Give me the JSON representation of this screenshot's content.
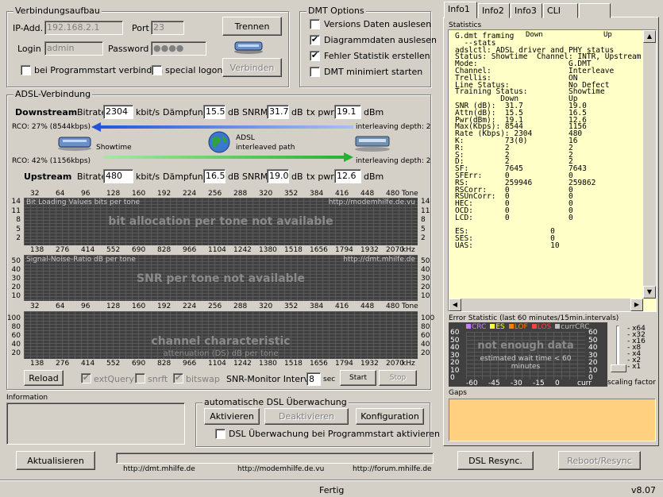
{
  "verbindung": {
    "title": "Verbindungsaufbau",
    "ip_label": "IP-Add.",
    "ip_value": "192.168.2.1",
    "port_label": "Port",
    "port_value": "23",
    "login_label": "Login",
    "login_value": "admin",
    "password_label": "Password",
    "password_value": "●●●●",
    "trennen": "Trennen",
    "verbinden": "Verbinden",
    "cb_start": "bei Programmstart verbinden",
    "cb_special": "special logon"
  },
  "dmt_options": {
    "title": "DMT Options",
    "items": [
      {
        "label": "Versions Daten auslesen",
        "checked": ""
      },
      {
        "label": "Diagrammdaten auslesen",
        "checked": "✔"
      },
      {
        "label": "Fehler Statistik erstellen",
        "checked": "✔"
      },
      {
        "label": "DMT minimiert starten",
        "checked": ""
      }
    ]
  },
  "adsl": {
    "title": "ADSL-Verbindung",
    "downstream": "Downstream",
    "upstream": "Upstream",
    "bitrate": "Bitrate",
    "kbits": "kbit/s",
    "daempfung": "Dämpfung",
    "db": "dB",
    "snrm": "SNRM",
    "txpwr": "tx pwr",
    "dbm": "dBm",
    "down_bitrate": "2304",
    "down_daempfung": "15.5",
    "down_snrm": "31.7",
    "down_txpwr": "19.1",
    "up_bitrate": "480",
    "up_daempfung": "16.5",
    "up_snrm": "19.0",
    "up_txpwr": "12.6",
    "rco_down": "RCO: 27% (8544kbps)",
    "rco_up": "RCO: 42% (1156kbps)",
    "interleave_down": "interleaving depth: 2",
    "interleave_up": "interleaving depth: 2",
    "showtime": "Showtime",
    "adsl_label": "ADSL",
    "interleaved": "interleaved path"
  },
  "charts": {
    "tone_axis": [
      "32",
      "64",
      "96",
      "128",
      "160",
      "192",
      "224",
      "256",
      "288",
      "320",
      "352",
      "384",
      "416",
      "448",
      "480",
      "Tone"
    ],
    "khz_axis": [
      "138",
      "276",
      "414",
      "552",
      "690",
      "828",
      "966",
      "1104",
      "1242",
      "1380",
      "1518",
      "1656",
      "1794",
      "1932",
      "2070",
      "kHz"
    ],
    "bit": {
      "title": "Bit Loading Values   bits per tone",
      "url": "http://modemhilfe.de.vu",
      "msg": "bit allocation per tone not available",
      "y": [
        "14",
        "11",
        "8",
        "5",
        "2"
      ]
    },
    "snr": {
      "title": "Signal-Noise-Ratio   dB per tone",
      "url": "http://dmt.mhilfe.de",
      "msg": "SNR per tone not available",
      "y": [
        "50",
        "40",
        "30",
        "20",
        "10"
      ]
    },
    "chan": {
      "msg": "channel characteristic",
      "sub": "attenuation (DS)   dB per tone",
      "y": [
        "100",
        "80",
        "60",
        "40",
        "20"
      ]
    }
  },
  "controls": {
    "reload": "Reload",
    "extquery": "extQuery",
    "snrft": "snrft",
    "bitswap": "bitswap",
    "snr_interval_label": "SNR-Monitor Interval:",
    "snr_interval": "8",
    "sec": "sec",
    "start": "Start",
    "stop": "Stop"
  },
  "information": {
    "title": "Information"
  },
  "auto_dsl": {
    "title": "automatische DSL Überwachung",
    "aktivieren": "Aktivieren",
    "deaktivieren": "Deaktivieren",
    "konfiguration": "Konfiguration",
    "cb_label": "DSL Überwachung bei Programmstart aktivieren"
  },
  "bottom": {
    "aktualisieren": "Aktualisieren",
    "link1": "http://dmt.mhilfe.de",
    "link2": "http://modemhilfe.de.vu",
    "link3": "http://forum.mhilfe.de",
    "dsl_resync": "DSL Resync.",
    "reboot_resync": "Reboot/Resync",
    "status": "Fertig",
    "version": "v8.07"
  },
  "tabs": [
    "Info1",
    "Info2",
    "Info3",
    "CLI",
    ""
  ],
  "statistics": {
    "title": "Statistics",
    "text": "G.dmt framing\n  --stats\nadslctl: ADSL driver and PHY status\nStatus: Showtime  Channel: INTR, Upstream\nMode:                    G.DMT\nChannel:                 Interleave\nTrellis:                 ON\nLine Status:             No Defect\nTraining Status:         Showtime\n          Down           Up\nSNR (dB):  31.7          19.0\nAttn(dB):  15.5          16.5\nPwr(dBm):  19.1          12.6\nMax(Kbps): 8544          1156\nRate (Kbps): 2304        480\nK:         73(0)         16\nR:         2             2\nS:         2             2\nD:         2             2\nSF:        7645          7643\nSFErr:     0             0\nRS:        259946        259862\nRSCorr:    0             0\nRSUnCorr:  0             0\nHEC:       0             0\nOCD:       0             0\nLCD:       0             0\n\nES:                  0\nSES:                 0\nUAS:                 10",
    "header_down": "Down",
    "header_up": "Up"
  },
  "error_stat": {
    "title": "Error Statistic (last 60 minutes/15min.intervals)",
    "legend": [
      "CRC",
      "ES",
      "LOF",
      "LOS",
      "currCRC"
    ],
    "legend_colors": [
      "#c080ff",
      "#ffff40",
      "#ff8000",
      "#ff4040",
      "#c0c0c0"
    ],
    "msg": "not enough data",
    "sub": "estimated wait time  < 60 minutes",
    "y": [
      "60",
      "50",
      "40",
      "30",
      "20",
      "10",
      "0"
    ],
    "x": [
      "-60",
      "-45",
      "-30",
      "-15",
      "0",
      "curr"
    ],
    "scale": [
      "x64",
      "x32",
      "x16",
      "x8",
      "x4",
      "x2",
      "x1"
    ],
    "scale_label": "scaling factor"
  },
  "gaps": {
    "title": "Gaps"
  }
}
